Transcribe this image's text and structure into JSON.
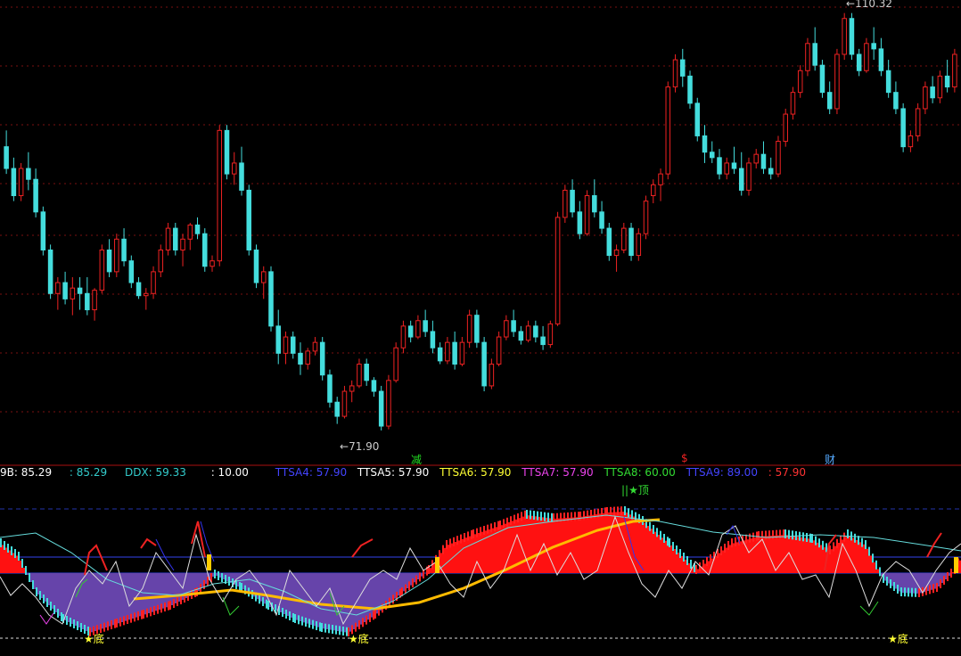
{
  "chart_data": [
    {
      "type": "candlestick",
      "title": "",
      "xlabel": "",
      "ylabel": "",
      "high_label": "110.32",
      "low_label": "71.90",
      "markers": [
        {
          "text": "减",
          "color": "#22dd22"
        },
        {
          "text": "$",
          "color": "#ee2222"
        },
        {
          "text": "财",
          "color": "#55aaff"
        }
      ],
      "candles": [
        [
          98,
          99.5,
          95.5,
          96.0
        ],
        [
          96,
          97,
          93,
          93.5
        ],
        [
          93.5,
          96.5,
          93,
          96
        ],
        [
          96,
          97.5,
          94,
          95
        ],
        [
          95,
          96,
          91.5,
          92
        ],
        [
          92,
          92.5,
          88,
          88.5
        ],
        [
          88.5,
          89,
          84,
          84.5
        ],
        [
          84.5,
          86,
          83,
          85.5
        ],
        [
          85.5,
          86.5,
          83.5,
          84
        ],
        [
          84,
          86,
          82.5,
          85
        ],
        [
          85,
          86,
          83,
          84.5
        ],
        [
          84.5,
          86,
          82.5,
          83
        ],
        [
          83,
          85,
          82,
          84.8
        ],
        [
          84.8,
          89,
          84.5,
          88.5
        ],
        [
          88.5,
          89.5,
          86,
          86.5
        ],
        [
          86.5,
          90,
          86,
          89.5
        ],
        [
          89.5,
          90.5,
          87,
          87.5
        ],
        [
          87.5,
          88,
          85,
          85.5
        ],
        [
          85.5,
          86,
          84,
          84.3
        ],
        [
          84.3,
          85,
          83,
          84.5
        ],
        [
          84.5,
          87,
          84,
          86.5
        ],
        [
          86.5,
          89,
          86,
          88.5
        ],
        [
          88.5,
          91,
          88,
          90.5
        ],
        [
          90.5,
          91,
          88,
          88.5
        ],
        [
          88.5,
          90,
          87,
          89.5
        ],
        [
          89.5,
          91,
          88.5,
          90.8
        ],
        [
          90.8,
          91.5,
          89.5,
          90
        ],
        [
          90,
          90.5,
          86.5,
          87
        ],
        [
          87,
          88,
          86.5,
          87.5
        ],
        [
          87.5,
          100,
          87,
          99.5
        ],
        [
          99.5,
          100,
          95,
          95.5
        ],
        [
          95.5,
          97.5,
          94.5,
          96.5
        ],
        [
          96.5,
          98,
          93.5,
          94
        ],
        [
          94,
          94.5,
          88,
          88.5
        ],
        [
          88.5,
          89,
          85,
          85.5
        ],
        [
          85.5,
          87,
          84,
          86.5
        ],
        [
          86.5,
          87,
          81,
          81.5
        ],
        [
          81.5,
          83,
          78,
          79
        ],
        [
          79,
          81,
          78,
          80.5
        ],
        [
          80.5,
          81,
          78.5,
          79
        ],
        [
          79,
          80,
          77,
          78
        ],
        [
          78,
          79.5,
          77.5,
          79.2
        ],
        [
          79.2,
          80.5,
          78.8,
          80
        ],
        [
          80,
          80.5,
          76.5,
          77
        ],
        [
          77,
          77.5,
          74,
          74.5
        ],
        [
          74.5,
          75,
          72.5,
          73.2
        ],
        [
          73.2,
          76,
          73,
          75.5
        ],
        [
          75.5,
          76.5,
          74.5,
          76
        ],
        [
          76,
          78.5,
          75.8,
          78
        ],
        [
          78,
          78.5,
          76,
          76.5
        ],
        [
          76.5,
          76.8,
          75,
          75.5
        ],
        [
          75.5,
          76,
          71.9,
          72.3
        ],
        [
          72.3,
          77,
          72,
          76.5
        ],
        [
          76.5,
          80,
          76.3,
          79.5
        ],
        [
          79.5,
          82,
          79,
          81.5
        ],
        [
          81.5,
          82,
          80,
          80.5
        ],
        [
          80.5,
          82.5,
          80.3,
          82
        ],
        [
          82,
          83,
          80.5,
          81
        ],
        [
          81,
          82,
          79,
          79.5
        ],
        [
          79.5,
          80,
          78,
          78.3
        ],
        [
          78.3,
          80.5,
          78,
          80
        ],
        [
          80,
          81,
          77.5,
          78
        ],
        [
          78,
          80.5,
          77.8,
          80
        ],
        [
          80,
          83,
          79.5,
          82.5
        ],
        [
          82.5,
          83,
          79.5,
          80
        ],
        [
          80,
          80.5,
          75.5,
          76
        ],
        [
          76,
          78.5,
          75.7,
          78
        ],
        [
          78,
          81,
          77.8,
          80.5
        ],
        [
          80.5,
          82.5,
          80.2,
          82
        ],
        [
          82,
          83,
          80.5,
          81
        ],
        [
          81,
          81.5,
          79.8,
          80.2
        ],
        [
          80.2,
          82,
          80,
          81.5
        ],
        [
          81.5,
          82,
          80,
          80.5
        ],
        [
          80.5,
          81.5,
          79.3,
          79.8
        ],
        [
          79.8,
          82,
          79.5,
          81.7
        ],
        [
          81.7,
          92,
          81.5,
          91.5
        ],
        [
          91.5,
          94.5,
          91,
          94
        ],
        [
          94,
          95,
          91.5,
          92
        ],
        [
          92,
          93,
          89.5,
          90
        ],
        [
          90,
          94,
          89.8,
          93.5
        ],
        [
          93.5,
          95,
          91.5,
          92
        ],
        [
          92,
          93,
          90,
          90.5
        ],
        [
          90.5,
          91,
          87.5,
          88
        ],
        [
          88,
          89,
          86.5,
          88.5
        ],
        [
          88.5,
          91,
          88.2,
          90.5
        ],
        [
          90.5,
          91,
          87.5,
          88
        ],
        [
          88,
          90.5,
          87.5,
          90
        ],
        [
          90,
          93.5,
          89.5,
          93
        ],
        [
          93.5,
          95,
          92.8,
          94.5
        ],
        [
          94.5,
          96,
          93,
          95.5
        ],
        [
          95.5,
          104,
          95,
          103.5
        ],
        [
          103.5,
          106.5,
          103,
          106
        ],
        [
          106,
          107,
          103.5,
          104.5
        ],
        [
          104.5,
          105,
          101.5,
          102
        ],
        [
          102,
          102.5,
          98.5,
          99
        ],
        [
          99,
          100,
          96.5,
          97.5
        ],
        [
          97.5,
          98.5,
          96.5,
          97
        ],
        [
          97,
          97.8,
          95,
          95.5
        ],
        [
          95.5,
          97,
          95,
          96.5
        ],
        [
          96.5,
          98,
          95.5,
          96
        ],
        [
          96,
          97.5,
          93.5,
          94
        ],
        [
          94,
          97,
          93.5,
          96.5
        ],
        [
          96.5,
          97.8,
          96,
          97.3
        ],
        [
          97.3,
          98.5,
          95.5,
          96
        ],
        [
          96,
          97,
          95,
          95.5
        ],
        [
          95.5,
          99,
          95.2,
          98.5
        ],
        [
          98.5,
          101.5,
          98,
          101
        ],
        [
          101,
          103.5,
          100.5,
          103
        ],
        [
          103,
          105.5,
          102.5,
          105
        ],
        [
          105,
          108,
          104.5,
          107.5
        ],
        [
          107.5,
          109,
          105,
          105.5
        ],
        [
          105.5,
          106,
          102.5,
          103
        ],
        [
          103,
          104,
          101,
          101.5
        ],
        [
          101.5,
          107,
          101,
          106.5
        ],
        [
          106.5,
          110.3,
          106,
          109.8
        ],
        [
          109.8,
          110.3,
          106,
          106.5
        ],
        [
          106.5,
          107,
          104.5,
          105
        ],
        [
          105,
          108,
          104.8,
          107.5
        ],
        [
          107.5,
          109,
          106,
          107
        ],
        [
          107,
          108,
          104.5,
          105
        ],
        [
          105,
          106,
          102.5,
          103
        ],
        [
          103,
          104,
          101,
          101.5
        ],
        [
          101.5,
          102,
          97.5,
          98
        ],
        [
          98,
          99.5,
          97.5,
          99
        ],
        [
          99,
          102,
          98.5,
          101.5
        ],
        [
          101.5,
          104,
          101,
          103.5
        ],
        [
          103.5,
          104.5,
          102,
          102.5
        ],
        [
          102.5,
          105,
          102,
          104.5
        ],
        [
          104.5,
          106,
          103,
          103.5
        ],
        [
          103.5,
          107,
          103,
          106.5
        ]
      ]
    },
    {
      "type": "indicator",
      "title": "",
      "legend": [
        {
          "text": "9B: 85.29",
          "color": "#ffffff"
        },
        {
          "text": ": 85.29",
          "color": "#33cccc"
        },
        {
          "text": "DDX: 59.33",
          "color": "#33cccc"
        },
        {
          "text": ": 10.00",
          "color": "#ffffff"
        },
        {
          "text": "TTSA4: 57.90",
          "color": "#4444ff"
        },
        {
          "text": "TTSA5: 57.90",
          "color": "#ffffff"
        },
        {
          "text": "TTSA6: 57.90",
          "color": "#ffff33"
        },
        {
          "text": "TTSA7: 57.90",
          "color": "#ee44ee"
        },
        {
          "text": "TTSA8: 60.00",
          "color": "#33dd33"
        },
        {
          "text": "TTSA9: 89.00",
          "color": "#4444ff"
        },
        {
          "text": ": 57.90",
          "color": "#ff3333"
        }
      ],
      "signals": [
        {
          "text": "★底"
        },
        {
          "text": "★底"
        },
        {
          "text": "★底"
        },
        {
          "text": "★顶"
        }
      ],
      "colors": {
        "up": "#ff2222",
        "down": "#44dddd",
        "fill_up": "#ff1111",
        "fill_down": "#6644aa",
        "trend": "#ffbb00"
      }
    }
  ]
}
